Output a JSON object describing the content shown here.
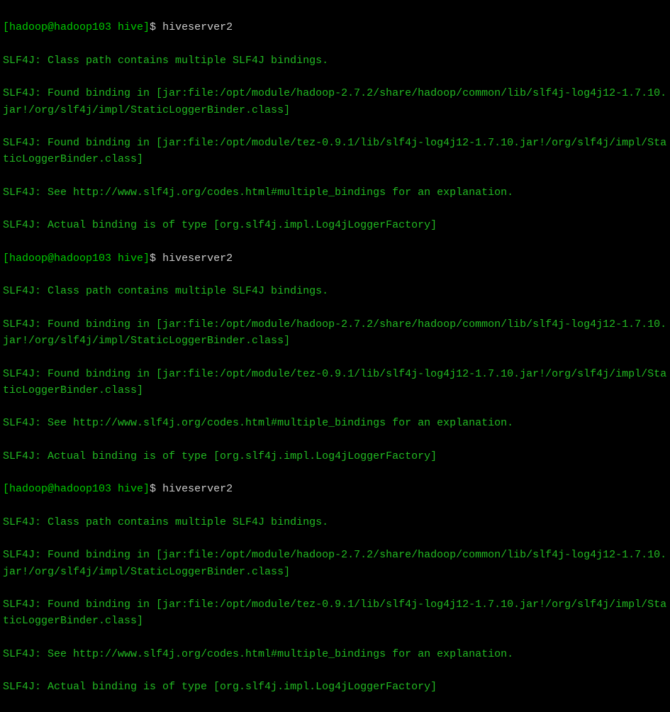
{
  "prompt": {
    "user_host_path": "[hadoop@hadoop103 hive]",
    "symbol": "$",
    "command": "hiveserver2"
  },
  "output": {
    "line1": "SLF4J: Class path contains multiple SLF4J bindings.",
    "line2": "SLF4J: Found binding in [jar:file:/opt/module/hadoop-2.7.2/share/hadoop/common/lib/slf4j-log4j12-1.7.10.jar!/org/slf4j/impl/StaticLoggerBinder.class]",
    "line3": "SLF4J: Found binding in [jar:file:/opt/module/tez-0.9.1/lib/slf4j-log4j12-1.7.10.jar!/org/slf4j/impl/StaticLoggerBinder.class]",
    "line4": "SLF4J: See http://www.slf4j.org/codes.html#multiple_bindings for an explanation.",
    "line5": "SLF4J: Actual binding is of type [org.slf4j.impl.Log4jLoggerFactory]"
  }
}
